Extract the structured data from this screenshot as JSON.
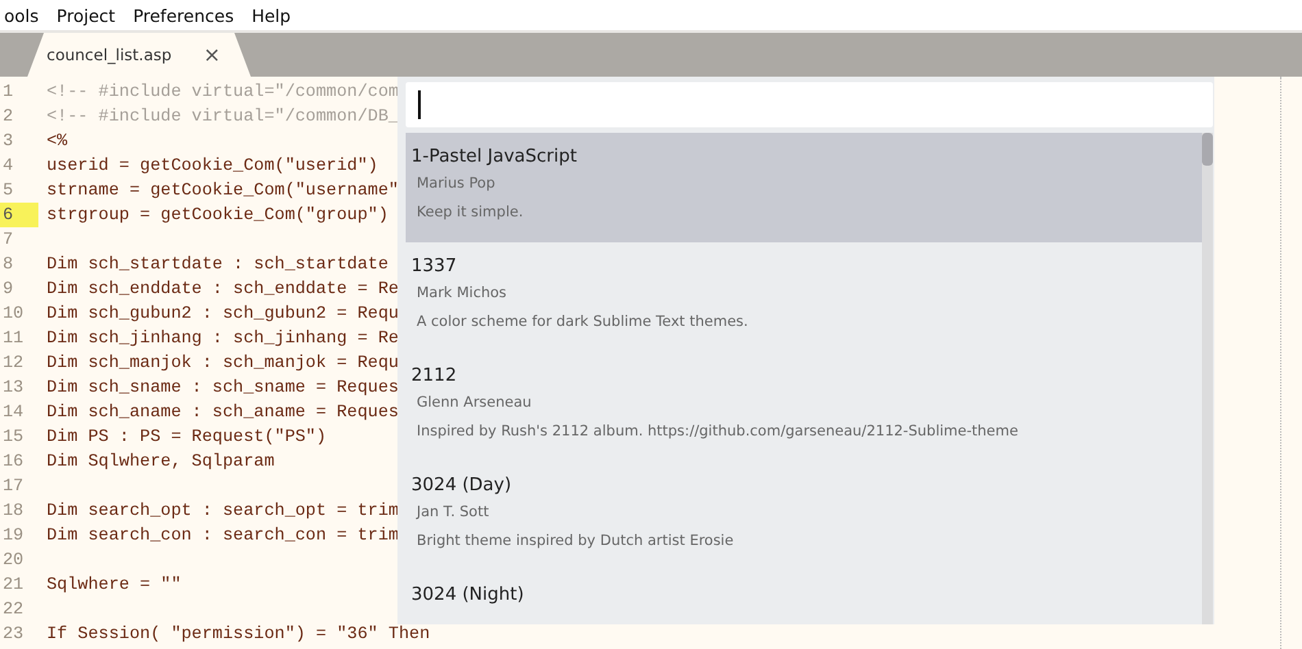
{
  "menu_bar": [
    "ools",
    "Project",
    "Preferences",
    "Help"
  ],
  "tabs": [
    {
      "label": "councel_list.asp",
      "close": "×",
      "selected": true
    }
  ],
  "editor": {
    "lines": [
      {
        "number": "1",
        "text": "<!-- #include virtual=\"/common/com",
        "kind": "comment",
        "selected": false
      },
      {
        "number": "2",
        "text": "<!-- #include virtual=\"/common/DB_",
        "kind": "comment",
        "selected": false
      },
      {
        "number": "3",
        "text": "<%",
        "kind": "code",
        "selected": false
      },
      {
        "number": "4",
        "text": "userid = getCookie_Com(\"userid\")",
        "kind": "code",
        "selected": false
      },
      {
        "number": "5",
        "text": "strname = getCookie_Com(\"username\"",
        "kind": "code",
        "selected": false
      },
      {
        "number": "6",
        "text": "strgroup = getCookie_Com(\"group\")",
        "kind": "code",
        "selected": true
      },
      {
        "number": "7",
        "selected": false
      },
      {
        "number": "8",
        "text": "Dim sch_startdate : sch_startdate",
        "kind": "code",
        "selected": false
      },
      {
        "number": "9",
        "text": "Dim sch_enddate : sch_enddate = Re",
        "kind": "code",
        "selected": false
      },
      {
        "number": "10",
        "text": "Dim sch_gubun2 : sch_gubun2 = Requ",
        "kind": "code",
        "selected": false
      },
      {
        "number": "11",
        "text": "Dim sch_jinhang : sch_jinhang = Re",
        "kind": "code",
        "selected": false
      },
      {
        "number": "12",
        "text": "Dim sch_manjok : sch_manjok = Requ",
        "kind": "code",
        "selected": false
      },
      {
        "number": "13",
        "text": "Dim sch_sname : sch_sname = Reques",
        "kind": "code",
        "selected": false
      },
      {
        "number": "14",
        "text": "Dim sch_aname : sch_aname = Reques",
        "kind": "code",
        "selected": false
      },
      {
        "number": "15",
        "text": "Dim PS : PS = Request(\"PS\")",
        "kind": "code",
        "selected": false
      },
      {
        "number": "16",
        "text": "Dim Sqlwhere, Sqlparam",
        "kind": "code",
        "selected": false
      },
      {
        "number": "17",
        "selected": false
      },
      {
        "number": "18",
        "text": "Dim search_opt : search_opt = trim",
        "kind": "code",
        "selected": false
      },
      {
        "number": "19",
        "text": "Dim search_con : search_con = trim",
        "kind": "code",
        "selected": false
      },
      {
        "number": "20",
        "selected": false
      },
      {
        "number": "21",
        "text": "Sqlwhere = \"\"",
        "kind": "code",
        "selected": false
      },
      {
        "number": "22",
        "selected": false
      },
      {
        "number": "23",
        "text": "If Session( \"permission\") = \"36\" Then",
        "kind": "code",
        "selected": false
      }
    ]
  },
  "command_palette": {
    "items": [
      {
        "title": "1-Pastel JavaScript",
        "author": "Marius Pop",
        "description": "Keep it simple.",
        "selected": true
      },
      {
        "title": "1337",
        "author": "Mark Michos",
        "description": "A color scheme for dark Sublime Text themes.",
        "selected": false
      },
      {
        "title": "2112",
        "author": "Glenn Arseneau",
        "description": "Inspired by Rush's 2112 album. https://github.com/garseneau/2112-Sublime-theme",
        "selected": false
      },
      {
        "title": "3024 (Day)",
        "author": "Jan T. Sott",
        "description": "Bright theme inspired by Dutch artist Erosie",
        "selected": false
      },
      {
        "title": "3024 (Night)",
        "selected": false
      }
    ]
  }
}
